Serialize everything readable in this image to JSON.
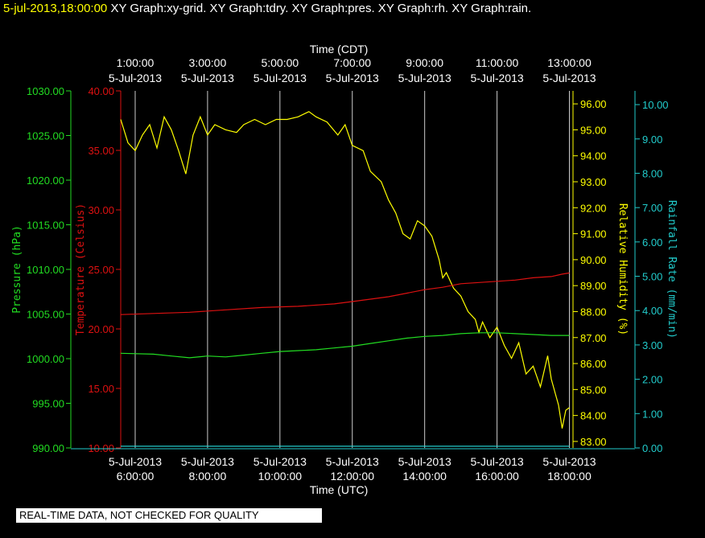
{
  "header": {
    "timestamp": "5-jul-2013,18:00:00",
    "graphs": "XY Graph:xy-grid.  XY Graph:tdry.  XY Graph:pres.  XY Graph:rh.  XY Graph:rain."
  },
  "footer": {
    "quality_note": "REAL-TIME DATA, NOT CHECKED FOR QUALITY"
  },
  "chart_data": {
    "type": "line",
    "x_top": {
      "label": "Time (CDT)",
      "ticks": [
        [
          "1:00:00",
          "5-Jul-2013"
        ],
        [
          "3:00:00",
          "5-Jul-2013"
        ],
        [
          "5:00:00",
          "5-Jul-2013"
        ],
        [
          "7:00:00",
          "5-Jul-2013"
        ],
        [
          "9:00:00",
          "5-Jul-2013"
        ],
        [
          "11:00:00",
          "5-Jul-2013"
        ],
        [
          "13:00:00",
          "5-Jul-2013"
        ]
      ]
    },
    "x_bottom": {
      "label": "Time (UTC)",
      "ticks": [
        [
          "5-Jul-2013",
          "6:00:00"
        ],
        [
          "5-Jul-2013",
          "8:00:00"
        ],
        [
          "5-Jul-2013",
          "10:00:00"
        ],
        [
          "5-Jul-2013",
          "12:00:00"
        ],
        [
          "5-Jul-2013",
          "14:00:00"
        ],
        [
          "5-Jul-2013",
          "16:00:00"
        ],
        [
          "5-Jul-2013",
          "18:00:00"
        ]
      ]
    },
    "xlim_hours_utc": [
      5.6,
      18.1
    ],
    "x_grid_hours_utc": [
      6,
      8,
      10,
      12,
      14,
      16,
      18
    ],
    "grid": true,
    "colors": {
      "pressure": "#22dd22",
      "temperature": "#dd1111",
      "humidity": "#ffff00",
      "rain": "#22cccc",
      "grid": "#cccccc"
    },
    "axes": {
      "pressure": {
        "label": "Pressure (hPa)",
        "ylim": [
          990,
          1030
        ],
        "ticks": [
          "990.00",
          "995.00",
          "1000.00",
          "1005.00",
          "1010.00",
          "1015.00",
          "1020.00",
          "1025.00",
          "1030.00"
        ]
      },
      "temperature": {
        "label": "Temperature (Celsius)",
        "ylim": [
          10,
          40
        ],
        "ticks": [
          "10.00",
          "15.00",
          "20.00",
          "25.00",
          "30.00",
          "35.00",
          "40.00"
        ]
      },
      "humidity": {
        "label": "Relative Humidity (%)",
        "ylim": [
          82.75,
          96.5
        ],
        "ticks": [
          "83.00",
          "84.00",
          "85.00",
          "86.00",
          "87.00",
          "88.00",
          "89.00",
          "90.00",
          "91.00",
          "92.00",
          "93.00",
          "94.00",
          "95.00",
          "96.00"
        ]
      },
      "rain": {
        "label": "Rainfall Rate (mm/min)",
        "ylim": [
          0,
          10.4
        ],
        "ticks": [
          "0.00",
          "1.00",
          "2.00",
          "3.00",
          "4.00",
          "5.00",
          "6.00",
          "7.00",
          "8.00",
          "9.00",
          "10.00"
        ]
      }
    },
    "series": [
      {
        "axis": "humidity",
        "x": [
          5.6,
          5.8,
          6.0,
          6.2,
          6.4,
          6.6,
          6.8,
          7.0,
          7.2,
          7.4,
          7.6,
          7.8,
          8.0,
          8.2,
          8.5,
          8.8,
          9.0,
          9.3,
          9.6,
          9.9,
          10.2,
          10.5,
          10.8,
          11.0,
          11.3,
          11.6,
          11.8,
          12.0,
          12.3,
          12.5,
          12.8,
          13.0,
          13.2,
          13.4,
          13.6,
          13.8,
          14.0,
          14.2,
          14.4,
          14.5,
          14.6,
          14.8,
          15.0,
          15.2,
          15.4,
          15.5,
          15.6,
          15.8,
          16.0,
          16.2,
          16.4,
          16.6,
          16.8,
          17.0,
          17.2,
          17.4,
          17.5,
          17.6,
          17.7,
          17.8,
          17.9,
          18.0
        ],
        "values": [
          95.4,
          94.5,
          94.2,
          94.8,
          95.2,
          94.3,
          95.5,
          95.0,
          94.2,
          93.3,
          94.8,
          95.5,
          94.8,
          95.2,
          95.0,
          94.9,
          95.2,
          95.4,
          95.2,
          95.4,
          95.4,
          95.5,
          95.7,
          95.5,
          95.3,
          94.8,
          95.2,
          94.4,
          94.2,
          93.4,
          93.0,
          92.3,
          91.8,
          91.0,
          90.8,
          91.5,
          91.3,
          90.9,
          90.0,
          89.3,
          89.5,
          88.9,
          88.6,
          88.0,
          87.7,
          87.2,
          87.6,
          87.0,
          87.4,
          86.7,
          86.2,
          86.8,
          85.6,
          85.9,
          85.1,
          86.3,
          85.4,
          84.9,
          84.4,
          83.5,
          84.2,
          84.3
        ]
      },
      {
        "axis": "temperature",
        "x": [
          5.6,
          6.5,
          7.5,
          8.5,
          9.5,
          10.5,
          11.5,
          12.0,
          12.5,
          13.0,
          13.5,
          14.0,
          14.5,
          15.0,
          15.5,
          16.0,
          16.5,
          17.0,
          17.5,
          17.8,
          18.0
        ],
        "values": [
          21.2,
          21.3,
          21.4,
          21.6,
          21.8,
          21.9,
          22.1,
          22.3,
          22.5,
          22.7,
          23.0,
          23.3,
          23.5,
          23.8,
          23.9,
          24.0,
          24.1,
          24.3,
          24.4,
          24.6,
          24.7
        ]
      },
      {
        "axis": "pressure",
        "x": [
          5.6,
          6.5,
          7.0,
          7.5,
          8.0,
          8.5,
          9.0,
          9.5,
          10.0,
          10.5,
          11.0,
          11.5,
          12.0,
          12.5,
          13.0,
          13.5,
          14.0,
          14.5,
          15.0,
          15.5,
          16.0,
          16.5,
          17.0,
          17.5,
          18.0
        ],
        "values": [
          1000.6,
          1000.5,
          1000.3,
          1000.1,
          1000.3,
          1000.2,
          1000.4,
          1000.6,
          1000.8,
          1000.9,
          1001.0,
          1001.2,
          1001.4,
          1001.7,
          1002.0,
          1002.3,
          1002.5,
          1002.6,
          1002.8,
          1002.9,
          1002.9,
          1002.8,
          1002.7,
          1002.6,
          1002.6
        ]
      },
      {
        "axis": "rain",
        "x": [
          5.6,
          18.0
        ],
        "values": [
          0.05,
          0.05
        ]
      }
    ]
  }
}
